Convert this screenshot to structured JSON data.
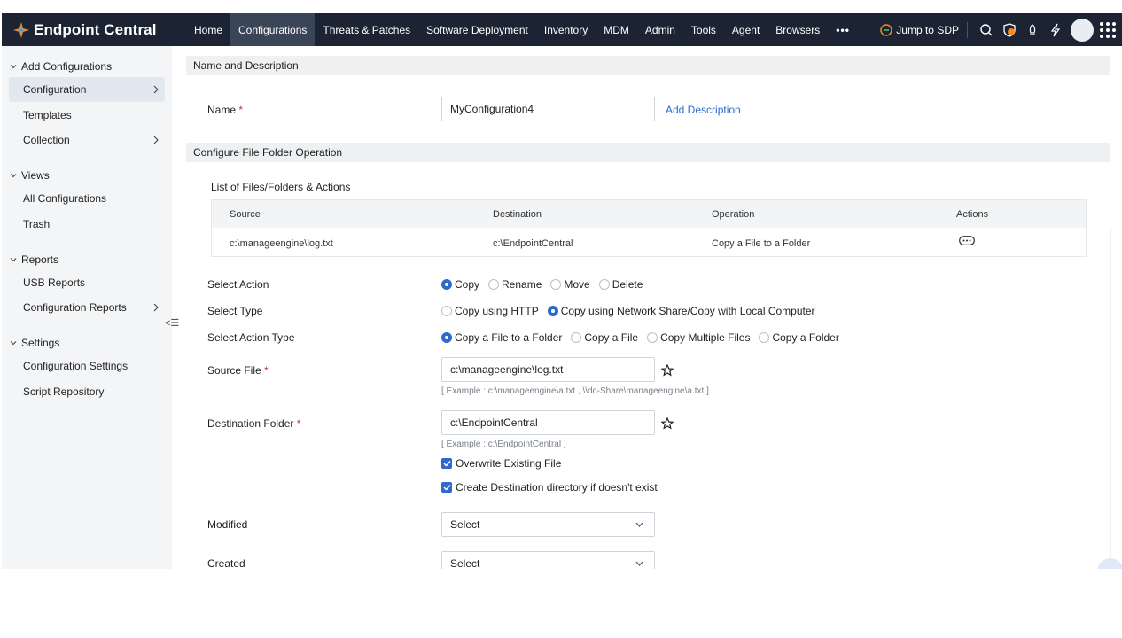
{
  "app": {
    "brand": "Endpoint Central",
    "nav": [
      "Home",
      "Configurations",
      "Threats & Patches",
      "Software Deployment",
      "Inventory",
      "MDM",
      "Admin",
      "Tools",
      "Agent",
      "Browsers"
    ],
    "nav_active": "Configurations",
    "nav_more": "•••",
    "jump_label": "Jump to SDP",
    "icons": [
      "search-icon",
      "shield-icon",
      "rocket-icon",
      "lightning-icon",
      "avatar",
      "apps-grid-icon"
    ]
  },
  "sidebar": {
    "sections": [
      {
        "title": "Add Configurations",
        "items": [
          {
            "label": "Configuration",
            "active": true,
            "has_arrow": true
          },
          {
            "label": "Templates",
            "active": false,
            "has_arrow": false
          },
          {
            "label": "Collection",
            "active": false,
            "has_arrow": true
          }
        ]
      },
      {
        "title": "Views",
        "items": [
          {
            "label": "All Configurations",
            "active": false,
            "has_arrow": false
          },
          {
            "label": "Trash",
            "active": false,
            "has_arrow": false
          }
        ]
      },
      {
        "title": "Reports",
        "items": [
          {
            "label": "USB Reports",
            "active": false,
            "has_arrow": false
          },
          {
            "label": "Configuration Reports",
            "active": false,
            "has_arrow": true
          }
        ]
      },
      {
        "title": "Settings",
        "items": [
          {
            "label": "Configuration Settings",
            "active": false,
            "has_arrow": false
          },
          {
            "label": "Script Repository",
            "active": false,
            "has_arrow": false
          }
        ]
      }
    ],
    "collapse_glyph": "<☰"
  },
  "form": {
    "name_section": "Name and Description",
    "name_label": "Name",
    "required_mark": "*",
    "name_value": "MyConfiguration4",
    "add_description": "Add Description",
    "op_section": "Configure File Folder Operation",
    "list_title": "List of Files/Folders & Actions",
    "table": {
      "headers": [
        "Source",
        "Destination",
        "Operation",
        "Actions"
      ],
      "row": [
        "c:\\manageengine\\log.txt",
        "c:\\EndpointCentral",
        "Copy a File to a Folder"
      ]
    },
    "select_action": {
      "label": "Select Action",
      "options": [
        "Copy",
        "Rename",
        "Move",
        "Delete"
      ],
      "selected": 0
    },
    "select_type": {
      "label": "Select Type",
      "options": [
        "Copy using HTTP",
        "Copy using Network Share/Copy with Local Computer"
      ],
      "selected": 1
    },
    "select_action_type": {
      "label": "Select Action Type",
      "options": [
        "Copy a File to a Folder",
        "Copy a File",
        "Copy Multiple Files",
        "Copy a Folder"
      ],
      "selected": 0
    },
    "source_file": {
      "label": "Source File",
      "value": "c:\\manageengine\\log.txt",
      "hint": "[ Example : c:\\manageengine\\a.txt , \\\\dc-Share\\manageengine\\a.txt ]"
    },
    "destination_folder": {
      "label": "Destination Folder",
      "value": "c:\\EndpointCentral",
      "hint": "[ Example : c:\\EndpointCentral ]"
    },
    "overwrite_label": "Overwrite Existing File",
    "create_dest_label": "Create Destination directory if doesn't exist",
    "modified": {
      "label": "Modified",
      "value": "Select"
    },
    "created": {
      "label": "Created",
      "value": "Select"
    }
  },
  "colors": {
    "topbar": "#1c2434",
    "accent": "#2d6acb",
    "sidebar": "#f4f5f7",
    "required": "#d03030"
  }
}
